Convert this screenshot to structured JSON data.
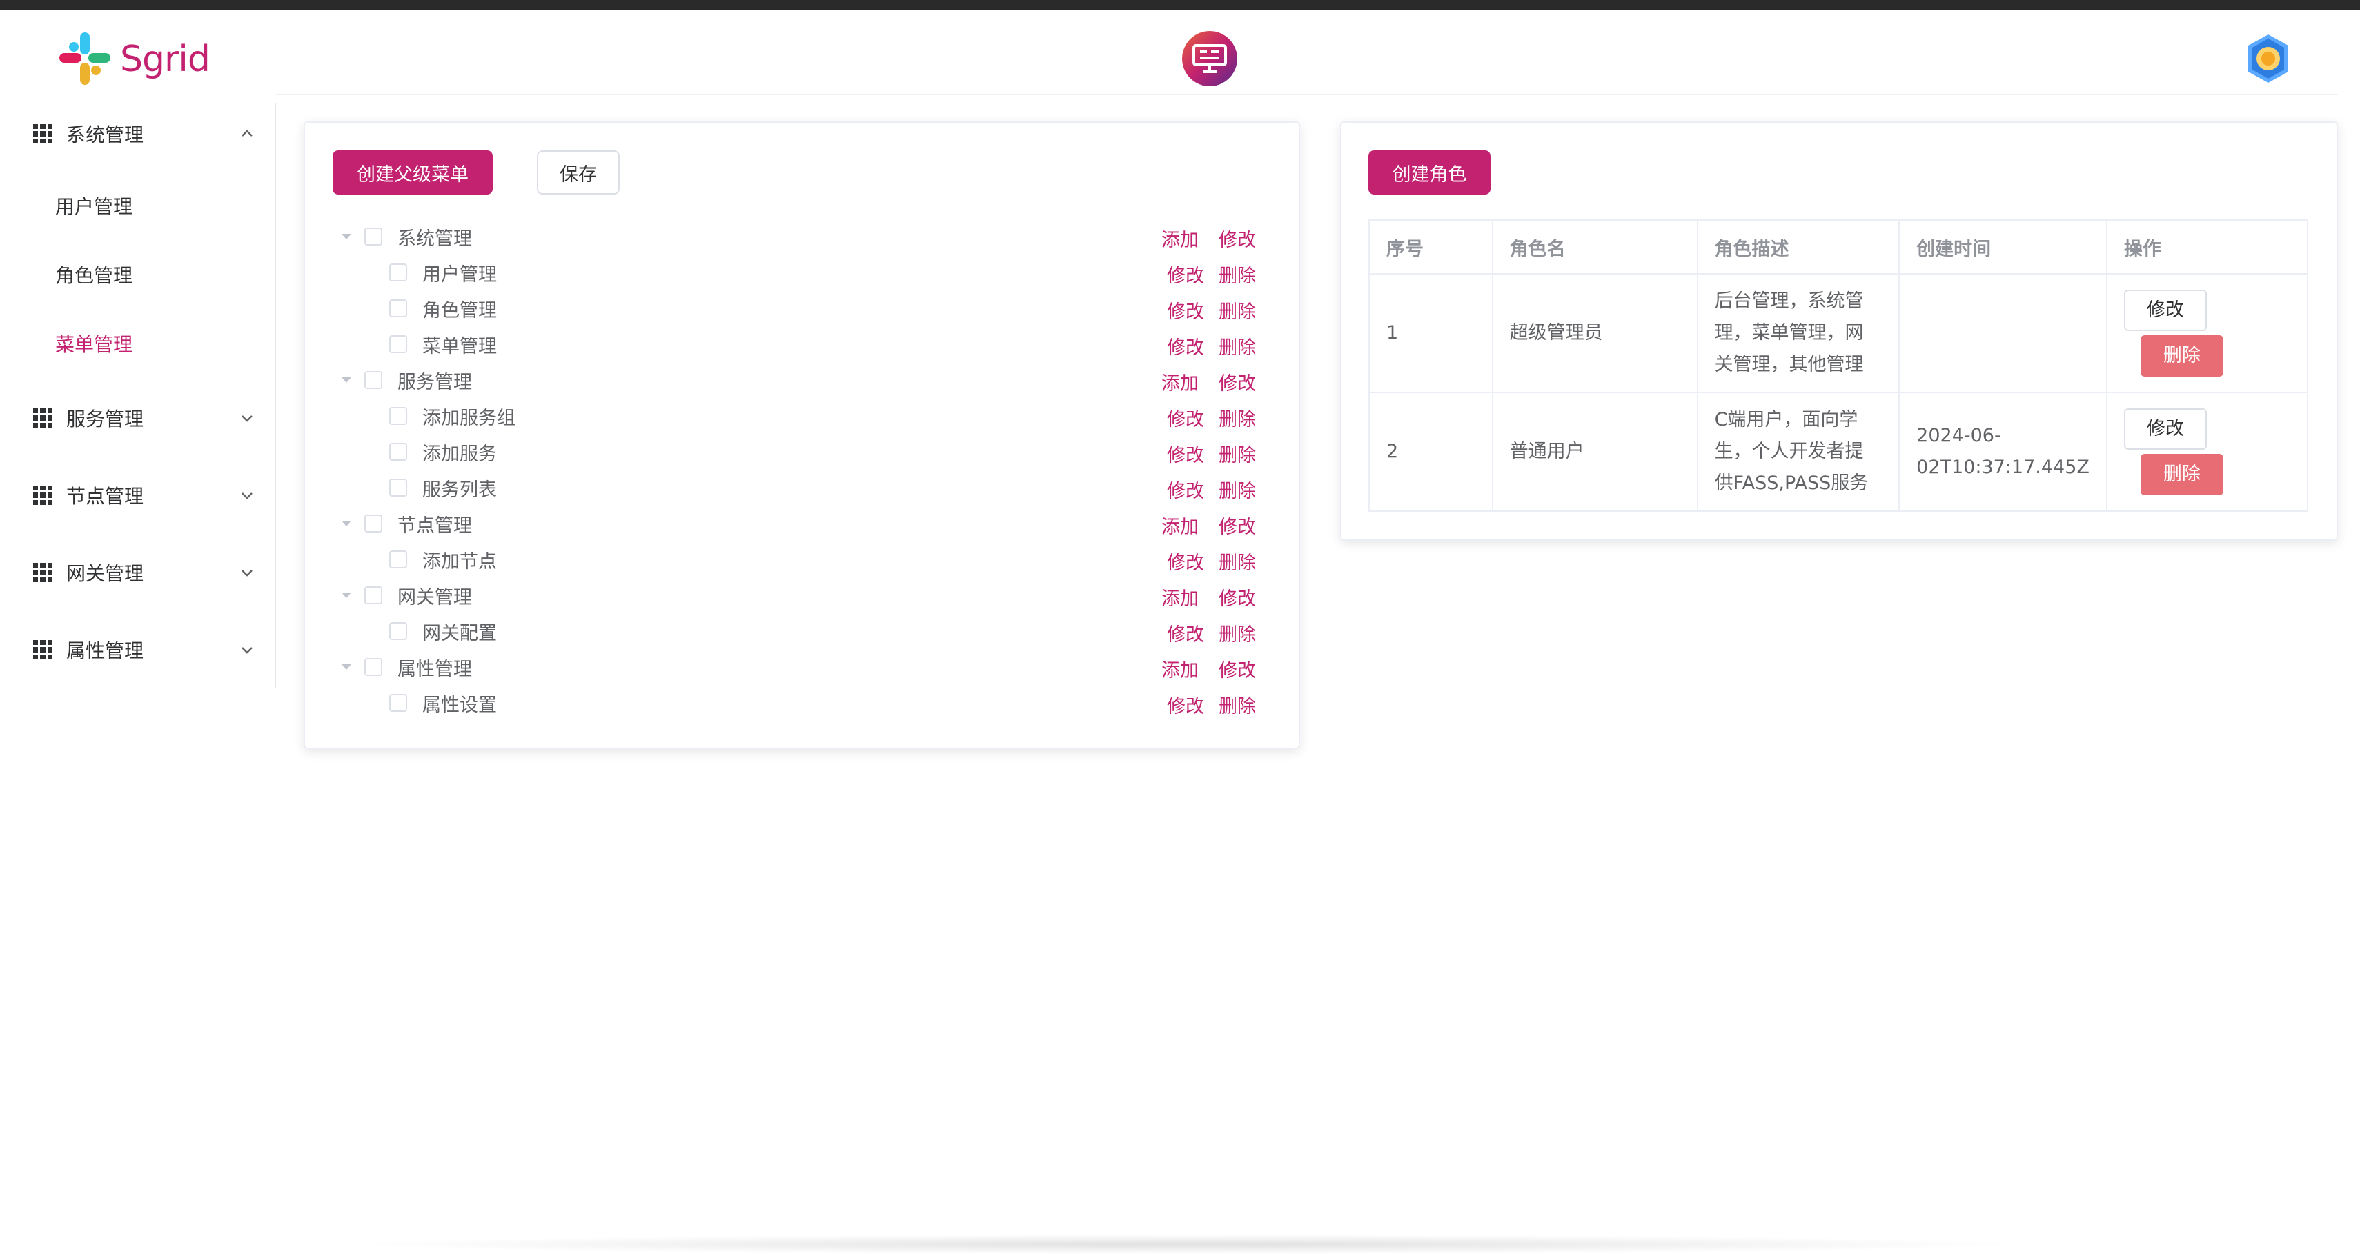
{
  "app": {
    "logo_text": "Sgrid"
  },
  "sidebar": {
    "groups": [
      {
        "label": "系统管理",
        "expanded": true,
        "children": [
          "用户管理",
          "角色管理",
          "菜单管理"
        ],
        "active_child": "菜单管理"
      },
      {
        "label": "服务管理",
        "expanded": false
      },
      {
        "label": "节点管理",
        "expanded": false
      },
      {
        "label": "网关管理",
        "expanded": false
      },
      {
        "label": "属性管理",
        "expanded": false
      }
    ]
  },
  "menu_panel": {
    "create_parent_label": "创建父级菜单",
    "save_label": "保存",
    "tree": [
      {
        "label": "系统管理",
        "level": 0,
        "actions": [
          "添加",
          "修改"
        ]
      },
      {
        "label": "用户管理",
        "level": 1,
        "actions": [
          "修改",
          "删除"
        ]
      },
      {
        "label": "角色管理",
        "level": 1,
        "actions": [
          "修改",
          "删除"
        ]
      },
      {
        "label": "菜单管理",
        "level": 1,
        "actions": [
          "修改",
          "删除"
        ]
      },
      {
        "label": "服务管理",
        "level": 0,
        "actions": [
          "添加",
          "修改"
        ]
      },
      {
        "label": "添加服务组",
        "level": 1,
        "actions": [
          "修改",
          "删除"
        ]
      },
      {
        "label": "添加服务",
        "level": 1,
        "actions": [
          "修改",
          "删除"
        ]
      },
      {
        "label": "服务列表",
        "level": 1,
        "actions": [
          "修改",
          "删除"
        ]
      },
      {
        "label": "节点管理",
        "level": 0,
        "actions": [
          "添加",
          "修改"
        ]
      },
      {
        "label": "添加节点",
        "level": 1,
        "actions": [
          "修改",
          "删除"
        ]
      },
      {
        "label": "网关管理",
        "level": 0,
        "actions": [
          "添加",
          "修改"
        ]
      },
      {
        "label": "网关配置",
        "level": 1,
        "actions": [
          "修改",
          "删除"
        ]
      },
      {
        "label": "属性管理",
        "level": 0,
        "actions": [
          "添加",
          "修改"
        ]
      },
      {
        "label": "属性设置",
        "level": 1,
        "actions": [
          "修改",
          "删除"
        ]
      }
    ]
  },
  "role_panel": {
    "create_role_label": "创建角色",
    "columns": [
      "序号",
      "角色名",
      "角色描述",
      "创建时间",
      "操作"
    ],
    "rows": [
      {
        "id": "1",
        "name": "超级管理员",
        "desc_lines": [
          "后台管理，系统管",
          "理，菜单管理，网",
          "关管理，其他管理"
        ],
        "time_lines": [],
        "edit": "修改",
        "delete": "删除"
      },
      {
        "id": "2",
        "name": "普通用户",
        "desc_lines": [
          "C端用户，面向学",
          "生，个人开发者提",
          "供FASS,PASS服务"
        ],
        "time_lines": [
          "2024-06-",
          "02T10:37:17.445Z"
        ],
        "edit": "修改",
        "delete": "删除"
      }
    ]
  },
  "colors": {
    "brand": "#c2226f",
    "danger": "#e86c74",
    "border": "#ebeef5"
  }
}
